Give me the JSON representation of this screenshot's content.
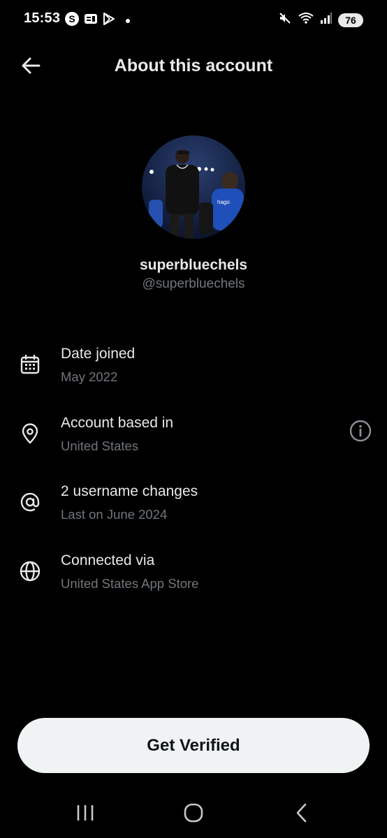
{
  "status_bar": {
    "time": "15:53",
    "battery": "76",
    "icons": [
      "s-app-icon",
      "notification-card-icon",
      "play-store-icon",
      "mute-icon",
      "wifi-icon",
      "signal-icon"
    ]
  },
  "header": {
    "title": "About this account",
    "back_icon": "arrow-left-icon"
  },
  "profile": {
    "display_name": "superbluechels",
    "handle": "@superbluechels"
  },
  "info_rows": [
    {
      "icon": "calendar-icon",
      "title": "Date joined",
      "subtitle": "May 2022"
    },
    {
      "icon": "location-pin-icon",
      "title": "Account based in",
      "subtitle": "United States",
      "extra_icon": "info-icon"
    },
    {
      "icon": "at-sign-icon",
      "title": "2 username changes",
      "subtitle": "Last on June 2024"
    },
    {
      "icon": "globe-icon",
      "title": "Connected via",
      "subtitle": "United States App Store"
    }
  ],
  "cta": {
    "label": "Get Verified"
  },
  "nav": {
    "icons": [
      "recent-apps-icon",
      "home-icon",
      "back-icon"
    ]
  },
  "colors": {
    "background": "#000000",
    "primary_text": "#e7e9ea",
    "secondary_text": "#71767b",
    "cta_background": "#eff3f4"
  }
}
